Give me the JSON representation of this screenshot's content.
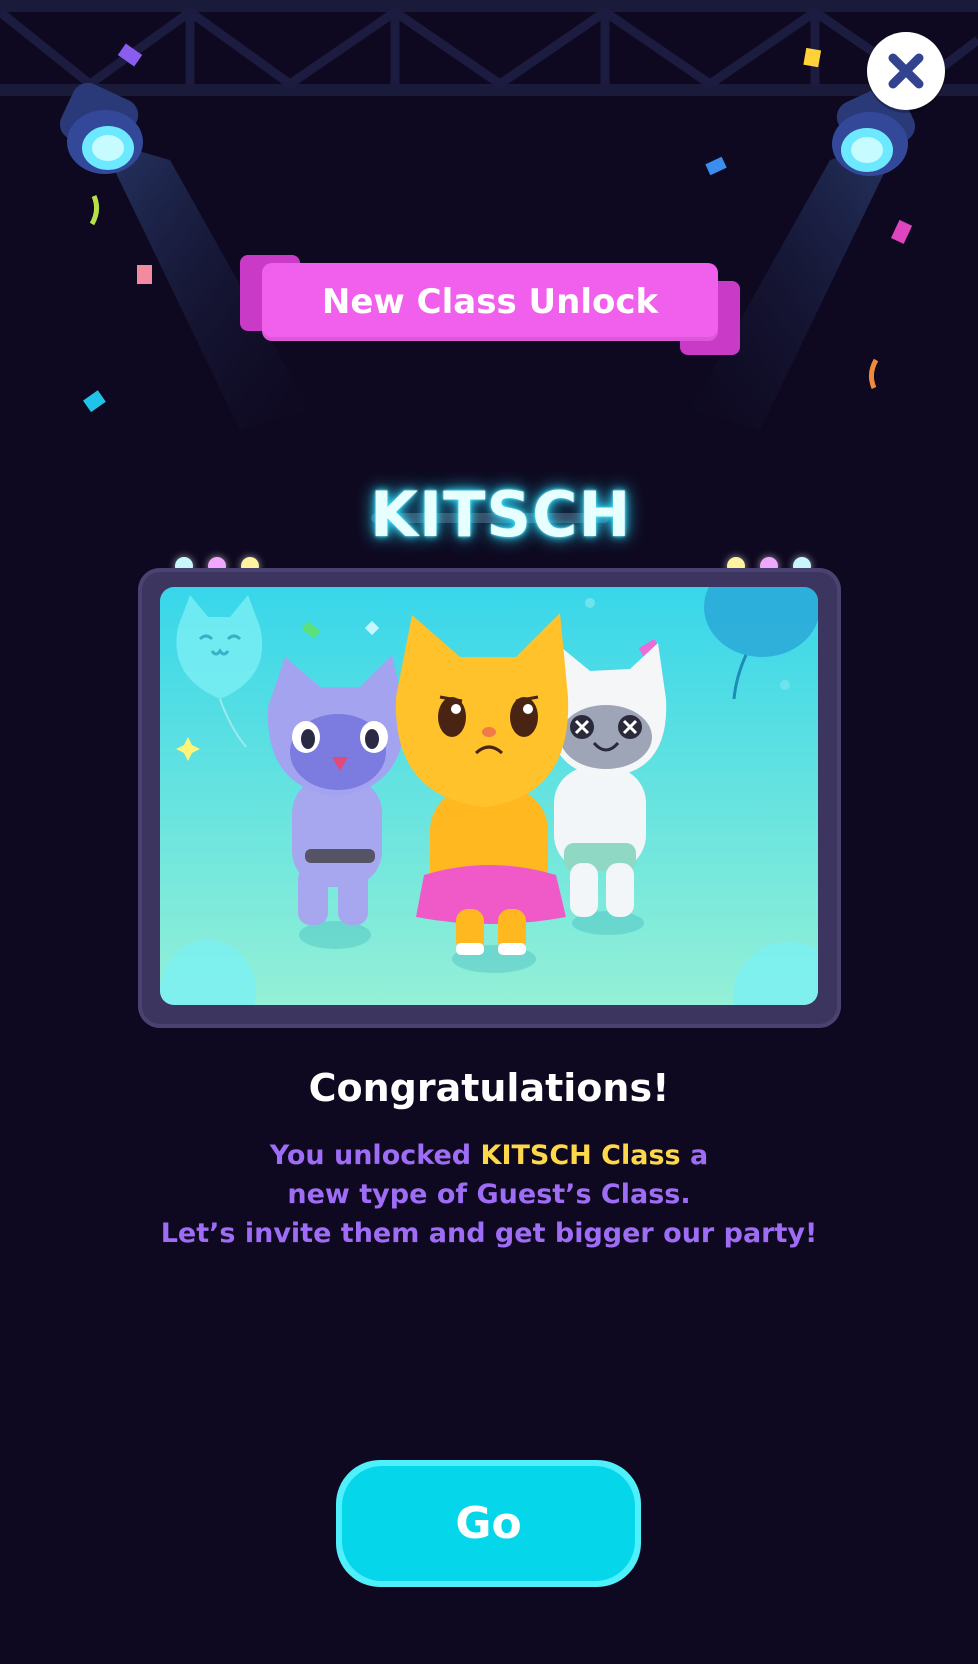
{
  "header": {
    "close_icon": "close-x-icon",
    "banner_text": "New Class Unlock"
  },
  "card": {
    "class_name": "KITSCH",
    "illustration": "three-cat-guests-illustration"
  },
  "message": {
    "title": "Congratulations!",
    "line1_prefix": "You unlocked ",
    "line1_highlight": "KITSCH Class",
    "line1_suffix": " a",
    "line2": "new type of Guest’s Class.",
    "line3": "Let’s invite them and get bigger our party!"
  },
  "actions": {
    "go_label": "Go"
  },
  "colors": {
    "background": "#0e0920",
    "banner": "#f060ec",
    "neon": "#31e6ff",
    "message": "#9f6cf5",
    "highlight": "#ffd84a",
    "button": "#05d6ea"
  }
}
